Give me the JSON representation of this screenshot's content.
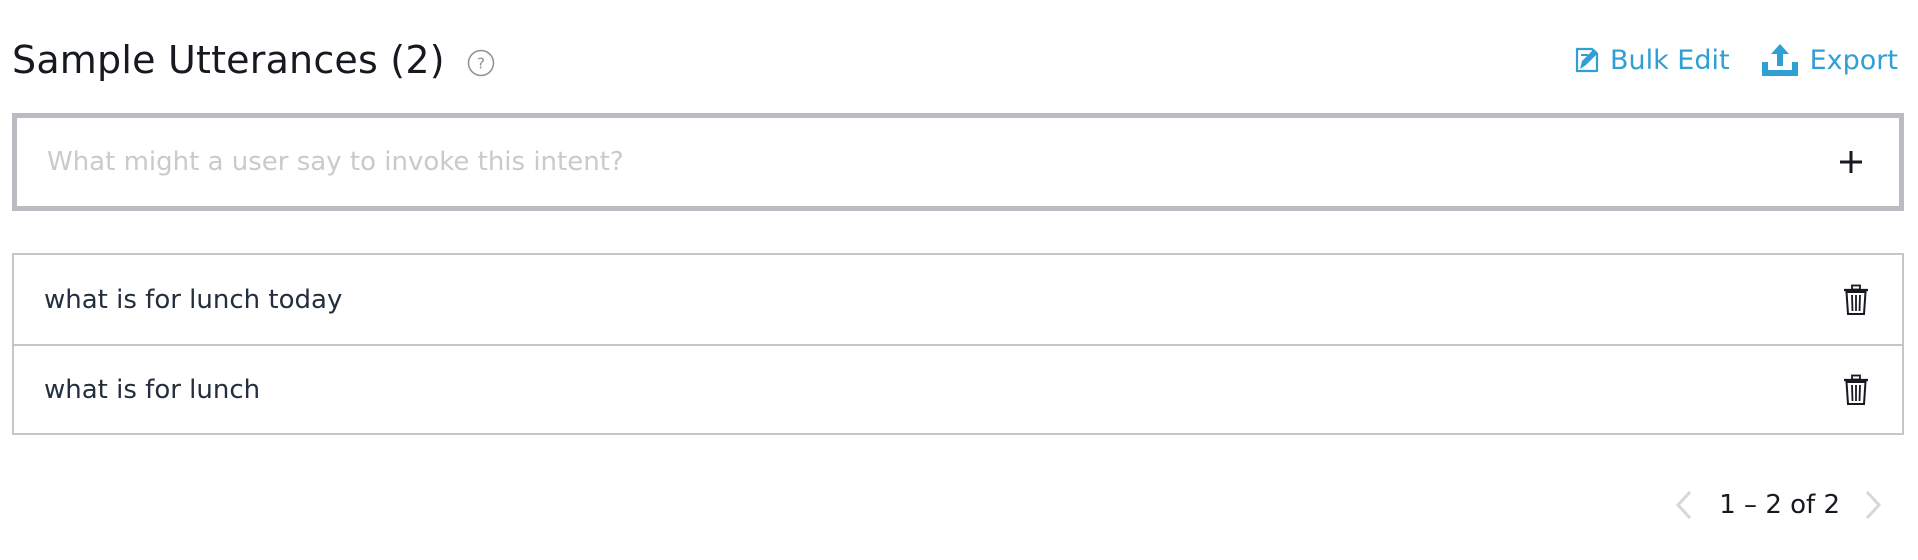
{
  "header": {
    "title": "Sample Utterances (2)",
    "help_icon": "help-circle-icon",
    "bulk_edit_label": "Bulk Edit",
    "bulk_edit_icon": "bulk-edit-icon",
    "export_label": "Export",
    "export_icon": "upload-icon"
  },
  "input": {
    "value": "",
    "placeholder": "What might a user say to invoke this intent?",
    "add_icon": "plus-icon"
  },
  "utterances": [
    {
      "text": "what is for lunch today",
      "delete_icon": "trash-icon"
    },
    {
      "text": "what is for lunch",
      "delete_icon": "trash-icon"
    }
  ],
  "pagination": {
    "label": "1 – 2 of 2",
    "prev_icon": "chevron-left-icon",
    "next_icon": "chevron-right-icon"
  },
  "colors": {
    "accent": "#2f9fd4",
    "text": "#16191f",
    "border": "#c4c6cb",
    "input_border": "#babcc2",
    "disabled": "#d5d7db"
  }
}
